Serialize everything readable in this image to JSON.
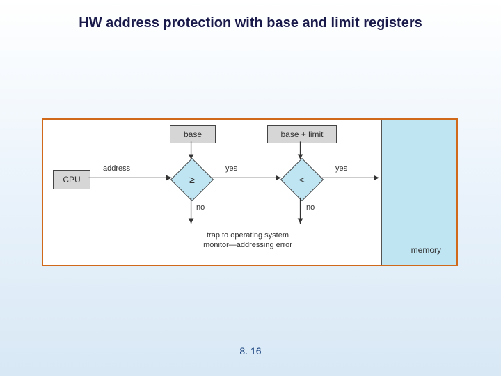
{
  "slide": {
    "title": "HW address protection with base and limit registers",
    "page_number": "8. 16"
  },
  "diagram": {
    "cpu": "CPU",
    "base_register": "base",
    "limit_register": "base + limit",
    "address_label": "address",
    "yes": "yes",
    "no": "no",
    "comparator_ge": "≥",
    "comparator_lt": "<",
    "trap_line1": "trap to operating system",
    "trap_line2": "monitor—addressing error",
    "memory": "memory"
  },
  "chart_data": {
    "type": "flowchart",
    "title": "HW address protection with base and limit registers",
    "nodes": [
      {
        "id": "cpu",
        "label": "CPU",
        "type": "process"
      },
      {
        "id": "base",
        "label": "base",
        "type": "register"
      },
      {
        "id": "base_limit",
        "label": "base + limit",
        "type": "register"
      },
      {
        "id": "ge",
        "label": "≥",
        "type": "decision"
      },
      {
        "id": "lt",
        "label": "<",
        "type": "decision"
      },
      {
        "id": "trap",
        "label": "trap to operating system monitor—addressing error",
        "type": "terminal"
      },
      {
        "id": "memory",
        "label": "memory",
        "type": "process"
      }
    ],
    "edges": [
      {
        "from": "cpu",
        "to": "ge",
        "label": "address"
      },
      {
        "from": "base",
        "to": "ge",
        "label": ""
      },
      {
        "from": "ge",
        "to": "lt",
        "label": "yes"
      },
      {
        "from": "ge",
        "to": "trap",
        "label": "no"
      },
      {
        "from": "base_limit",
        "to": "lt",
        "label": ""
      },
      {
        "from": "lt",
        "to": "memory",
        "label": "yes"
      },
      {
        "from": "lt",
        "to": "trap",
        "label": "no"
      }
    ]
  }
}
